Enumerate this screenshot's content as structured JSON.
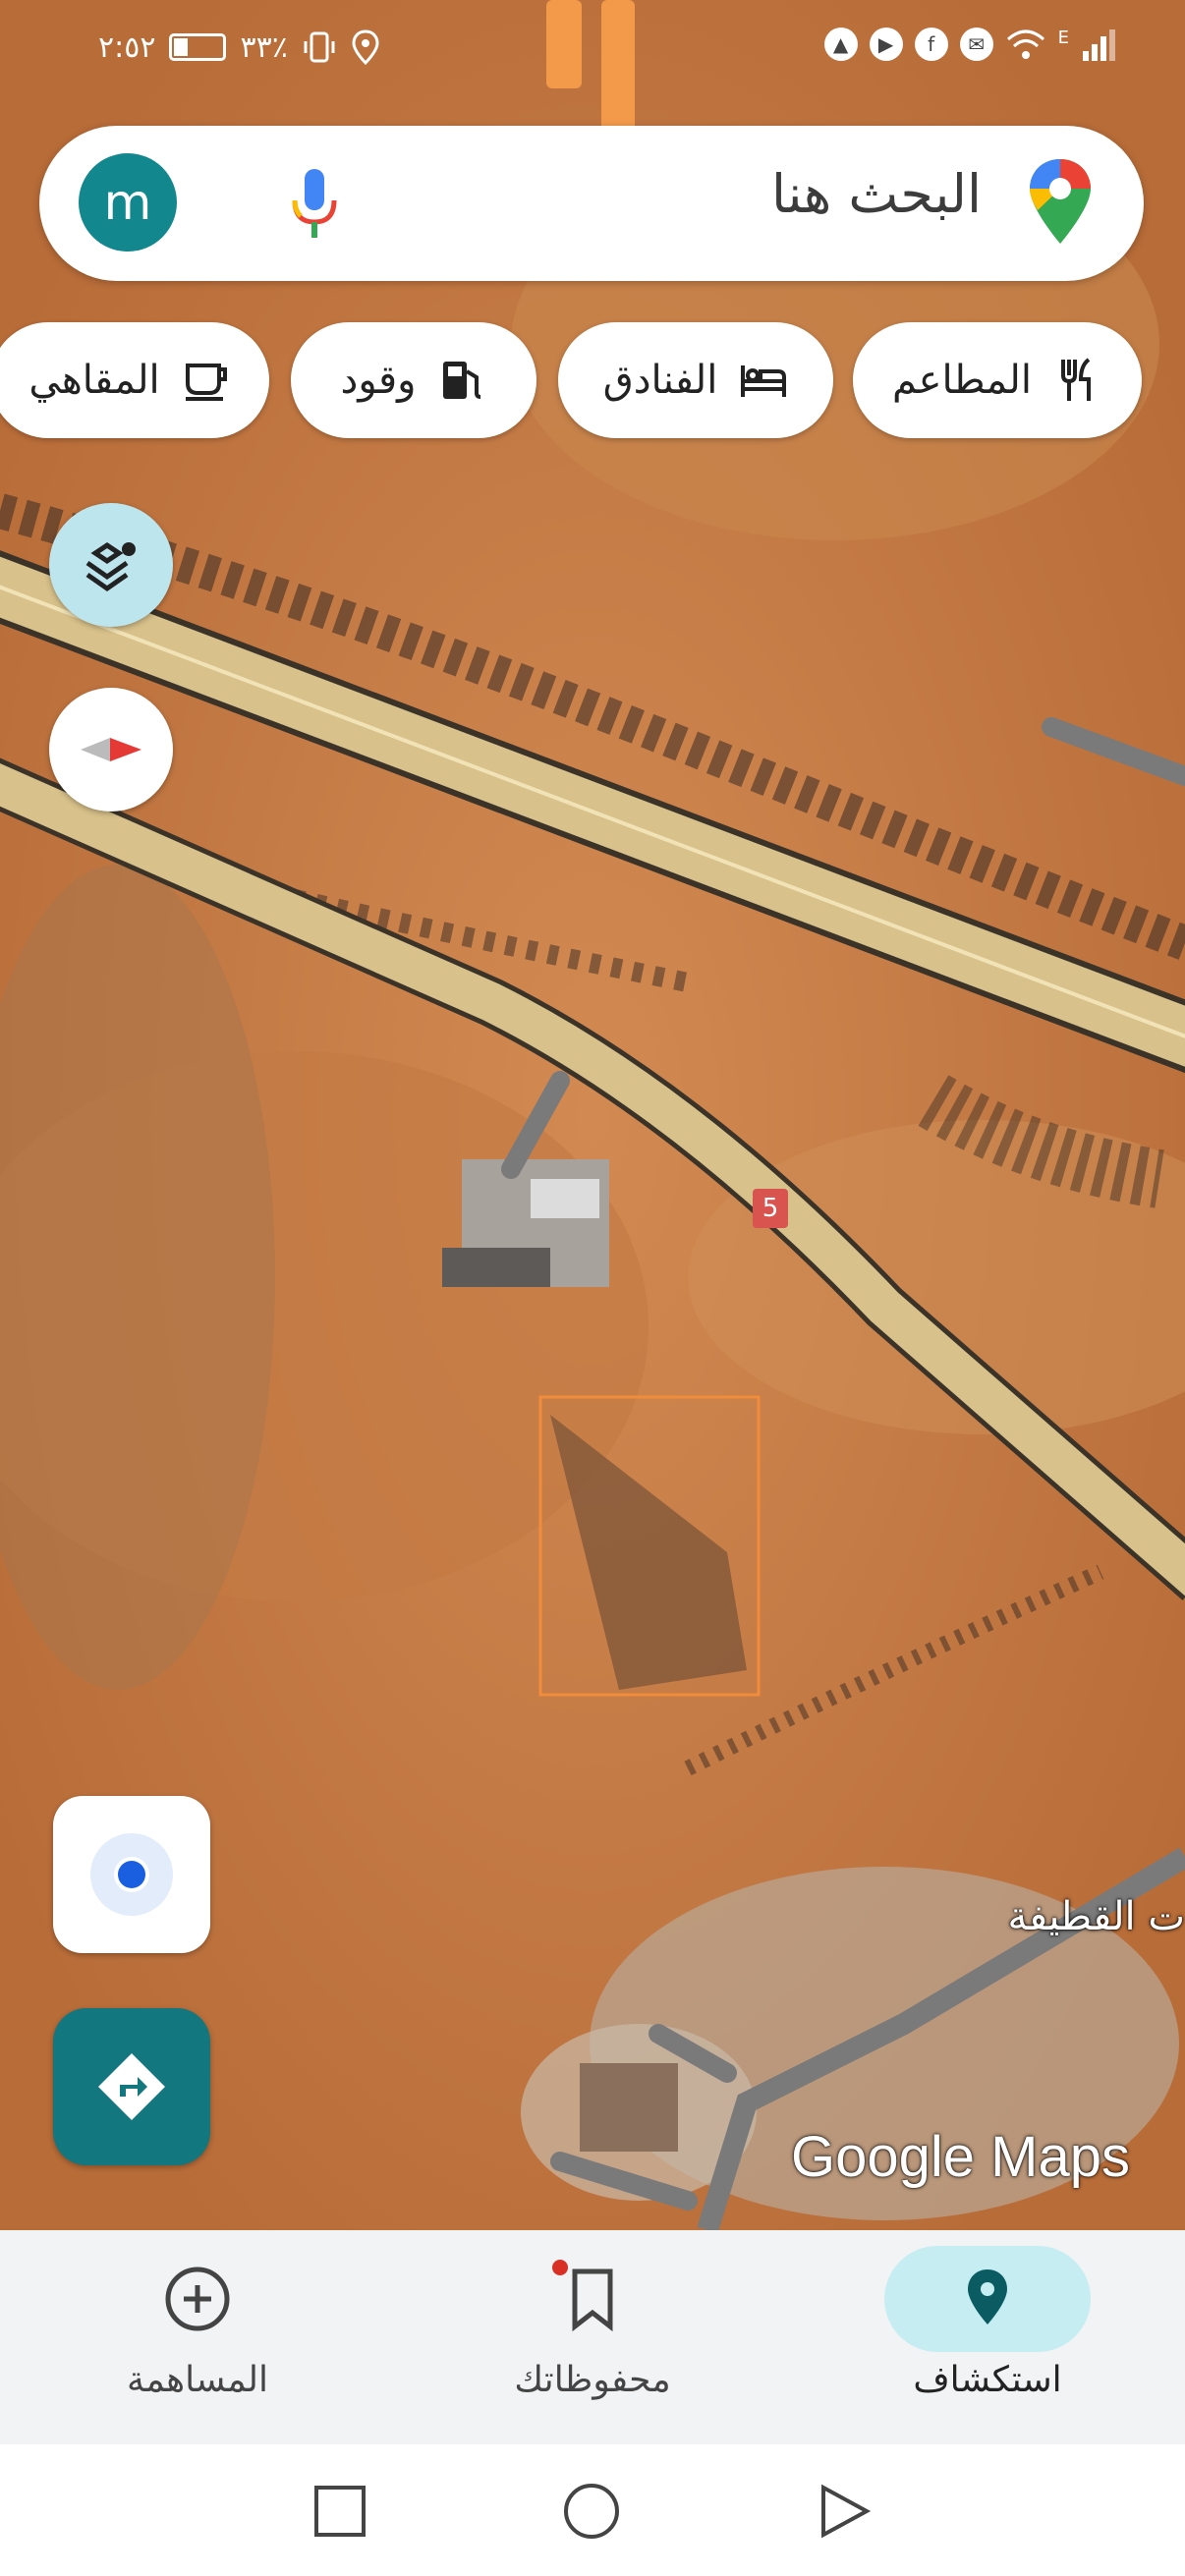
{
  "status_bar": {
    "time": "٢:٥٢",
    "battery": "٣٣٪",
    "network_label": "E"
  },
  "search": {
    "placeholder": "البحث هنا",
    "avatar_letter": "m"
  },
  "categories": [
    {
      "label": "المطاعم",
      "icon": "restaurant-icon"
    },
    {
      "label": "الفنادق",
      "icon": "hotel-icon"
    },
    {
      "label": "وقود",
      "icon": "gas-station-icon"
    },
    {
      "label": "المقاهي",
      "icon": "coffee-icon"
    }
  ],
  "map": {
    "route_shield": "5",
    "place_label": "ت القطيفة",
    "watermark": "Google Maps"
  },
  "bottom_nav": [
    {
      "label": "استكشاف",
      "icon": "explore-pin-icon",
      "active": true
    },
    {
      "label": "محفوظاتك",
      "icon": "bookmark-icon",
      "active": false
    },
    {
      "label": "المساهمة",
      "icon": "add-circle-icon",
      "active": false
    }
  ],
  "colors": {
    "accent": "#12777f",
    "avatar": "#12878d",
    "active_nav_bg": "#c6edf2",
    "road_fill": "#d8c18a",
    "selection_outline": "#f08c3c"
  }
}
